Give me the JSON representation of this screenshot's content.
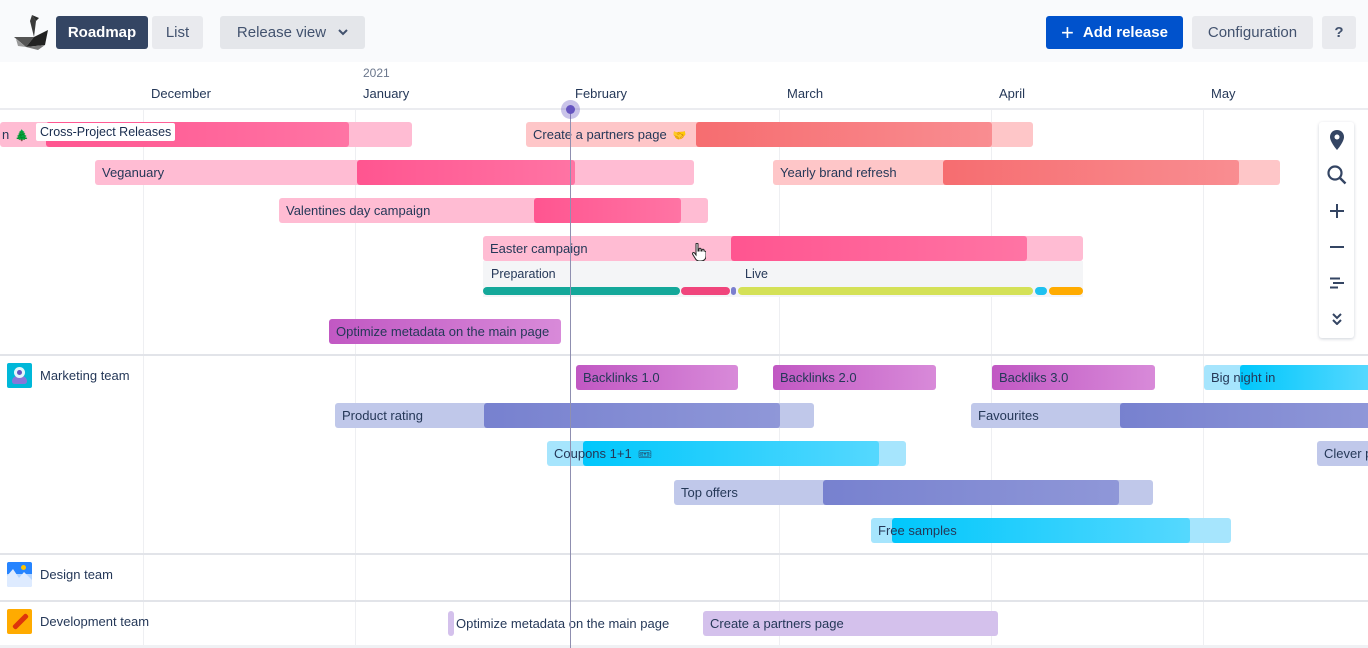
{
  "toolbar": {
    "logo_icon": "swan-logo-icon",
    "roadmap_label": "Roadmap",
    "list_label": "List",
    "release_view_label": "Release view",
    "release_view_chevron": "⌄",
    "add_release_label": "Add release",
    "add_release_icon": "+",
    "configuration_label": "Configuration",
    "help_label": "?"
  },
  "timeline": {
    "year": "2021",
    "months": [
      "December",
      "January",
      "February",
      "March",
      "April",
      "May"
    ],
    "today": "early February"
  },
  "sections": {
    "cross_project": {
      "tag": "Cross-Project Releases",
      "bars": [
        {
          "label": "n",
          "emoji": "🌲"
        },
        {
          "label": "Create a partners page",
          "emoji": "🤝"
        },
        {
          "label": "Veganuary"
        },
        {
          "label": "Yearly brand refresh"
        },
        {
          "label": "Valentines day campaign"
        },
        {
          "label": "Easter campaign"
        },
        {
          "label": "Optimize metadata on the main page"
        }
      ],
      "easter_phases": {
        "labels": [
          "Preparation",
          "Live"
        ],
        "segment_colors": [
          "#14a89a",
          "#f0457c",
          "#7b7fcf",
          "#d4e157",
          "#1ec1f0",
          "#ffab00"
        ]
      }
    },
    "marketing": {
      "name": "Marketing team",
      "icon": "robot-avatar-icon",
      "bars": [
        {
          "label": "Backlinks 1.0"
        },
        {
          "label": "Backlinks 2.0"
        },
        {
          "label": "Backliks 3.0"
        },
        {
          "label": "Big night in"
        },
        {
          "label": "Product rating"
        },
        {
          "label": "Favourites"
        },
        {
          "label": "Coupons 1+1",
          "emoji": "🎟"
        },
        {
          "label": "Clever p"
        },
        {
          "label": "Top offers"
        },
        {
          "label": "Free samples"
        }
      ]
    },
    "design": {
      "name": "Design team",
      "icon": "mountain-avatar-icon"
    },
    "development": {
      "name": "Development team",
      "icon": "pencil-avatar-icon",
      "bars": [
        {
          "label": "Optimize metadata on the main page"
        },
        {
          "label": "Create a partners page"
        }
      ]
    }
  },
  "side_tools": [
    "location-pin-icon",
    "search-icon",
    "zoom-in-icon",
    "zoom-out-icon",
    "sort-lines-icon",
    "expand-all-icon"
  ],
  "colors": {
    "primary": "#0052cc",
    "roadmap_active": "#344563",
    "today_marker": "#6554c0"
  }
}
